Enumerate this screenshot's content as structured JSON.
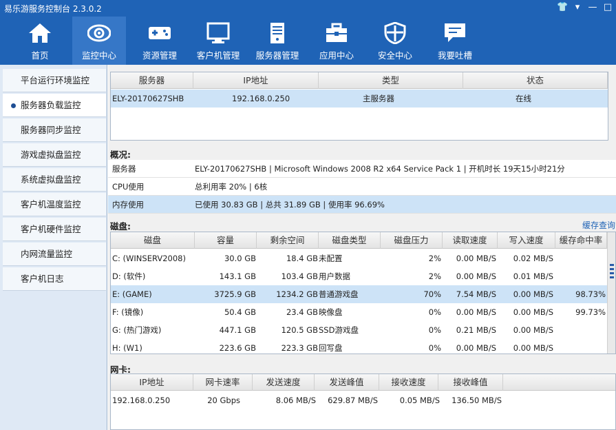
{
  "window": {
    "title": "易乐游服务控制台 2.3.0.2"
  },
  "toolbar": [
    {
      "label": "首页",
      "icon": "home-icon"
    },
    {
      "label": "监控中心",
      "icon": "eye-icon"
    },
    {
      "label": "资源管理",
      "icon": "gamepad-icon"
    },
    {
      "label": "客户机管理",
      "icon": "monitor-icon"
    },
    {
      "label": "服务器管理",
      "icon": "server-icon"
    },
    {
      "label": "应用中心",
      "icon": "toolbox-icon"
    },
    {
      "label": "安全中心",
      "icon": "shield-icon"
    },
    {
      "label": "我要吐槽",
      "icon": "chat-icon"
    }
  ],
  "sidebar": [
    {
      "label": "平台运行环境监控"
    },
    {
      "label": "服务器负载监控"
    },
    {
      "label": "服务器同步监控"
    },
    {
      "label": "游戏虚拟盘监控"
    },
    {
      "label": "系统虚拟盘监控"
    },
    {
      "label": "客户机温度监控"
    },
    {
      "label": "客户机硬件监控"
    },
    {
      "label": "内网流量监控"
    },
    {
      "label": "客户机日志"
    }
  ],
  "servers": {
    "headers": [
      "服务器",
      "IP地址",
      "类型",
      "状态"
    ],
    "rows": [
      {
        "name": "ELY-20170627SHB",
        "ip": "192.168.0.250",
        "type": "主服务器",
        "status": "在线"
      }
    ]
  },
  "overview": {
    "title": "概况:",
    "rows": [
      {
        "key": "服务器",
        "value": "ELY-20170627SHB | Microsoft Windows 2008 R2 x64 Service Pack 1 | 开机时长 19天15小时21分"
      },
      {
        "key": "CPU使用",
        "value": "总利用率 20% | 6核"
      },
      {
        "key": "内存使用",
        "value": "已使用 30.83 GB | 总共 31.89 GB | 使用率 96.69%"
      }
    ]
  },
  "disks": {
    "title": "磁盘:",
    "cache_link": "缓存查询",
    "headers": [
      "磁盘",
      "容量",
      "剩余空间",
      "磁盘类型",
      "磁盘压力",
      "读取速度",
      "写入速度",
      "缓存命中率"
    ],
    "rows": [
      {
        "disk": "C: (WINSERV2008)",
        "cap": "30.0  GB",
        "free": "18.4  GB",
        "type": "未配置",
        "load": "2%",
        "read": "0.00  MB/S",
        "write": "0.02  MB/S",
        "hit": ""
      },
      {
        "disk": "D: (软件)",
        "cap": "143.1  GB",
        "free": "103.4  GB",
        "type": "用户数据",
        "load": "2%",
        "read": "0.00  MB/S",
        "write": "0.01  MB/S",
        "hit": ""
      },
      {
        "disk": "E: (GAME)",
        "cap": "3725.9  GB",
        "free": "1234.2  GB",
        "type": "普通游戏盘",
        "load": "70%",
        "read": "7.54  MB/S",
        "write": "0.00  MB/S",
        "hit": "98.73%"
      },
      {
        "disk": "F: (镜像)",
        "cap": "50.4  GB",
        "free": "23.4  GB",
        "type": "映像盘",
        "load": "0%",
        "read": "0.00  MB/S",
        "write": "0.00  MB/S",
        "hit": "99.73%"
      },
      {
        "disk": "G: (热门游戏)",
        "cap": "447.1  GB",
        "free": "120.5  GB",
        "type": "SSD游戏盘",
        "load": "0%",
        "read": "0.21  MB/S",
        "write": "0.00  MB/S",
        "hit": ""
      },
      {
        "disk": "H: (W1)",
        "cap": "223.6  GB",
        "free": "223.3  GB",
        "type": "回写盘",
        "load": "0%",
        "read": "0.00  MB/S",
        "write": "0.00  MB/S",
        "hit": ""
      }
    ]
  },
  "nic": {
    "title": "网卡:",
    "headers": [
      "IP地址",
      "网卡速率",
      "发送速度",
      "发送峰值",
      "接收速度",
      "接收峰值"
    ],
    "rows": [
      {
        "ip": "192.168.0.250",
        "rate": "20 Gbps",
        "send": "8.06  MB/S",
        "send_peak": "629.87  MB/S",
        "recv": "0.05  MB/S",
        "recv_peak": "136.50  MB/S"
      }
    ]
  },
  "colors": {
    "accent": "#1f63b6",
    "selected_row": "#cde3f7"
  }
}
